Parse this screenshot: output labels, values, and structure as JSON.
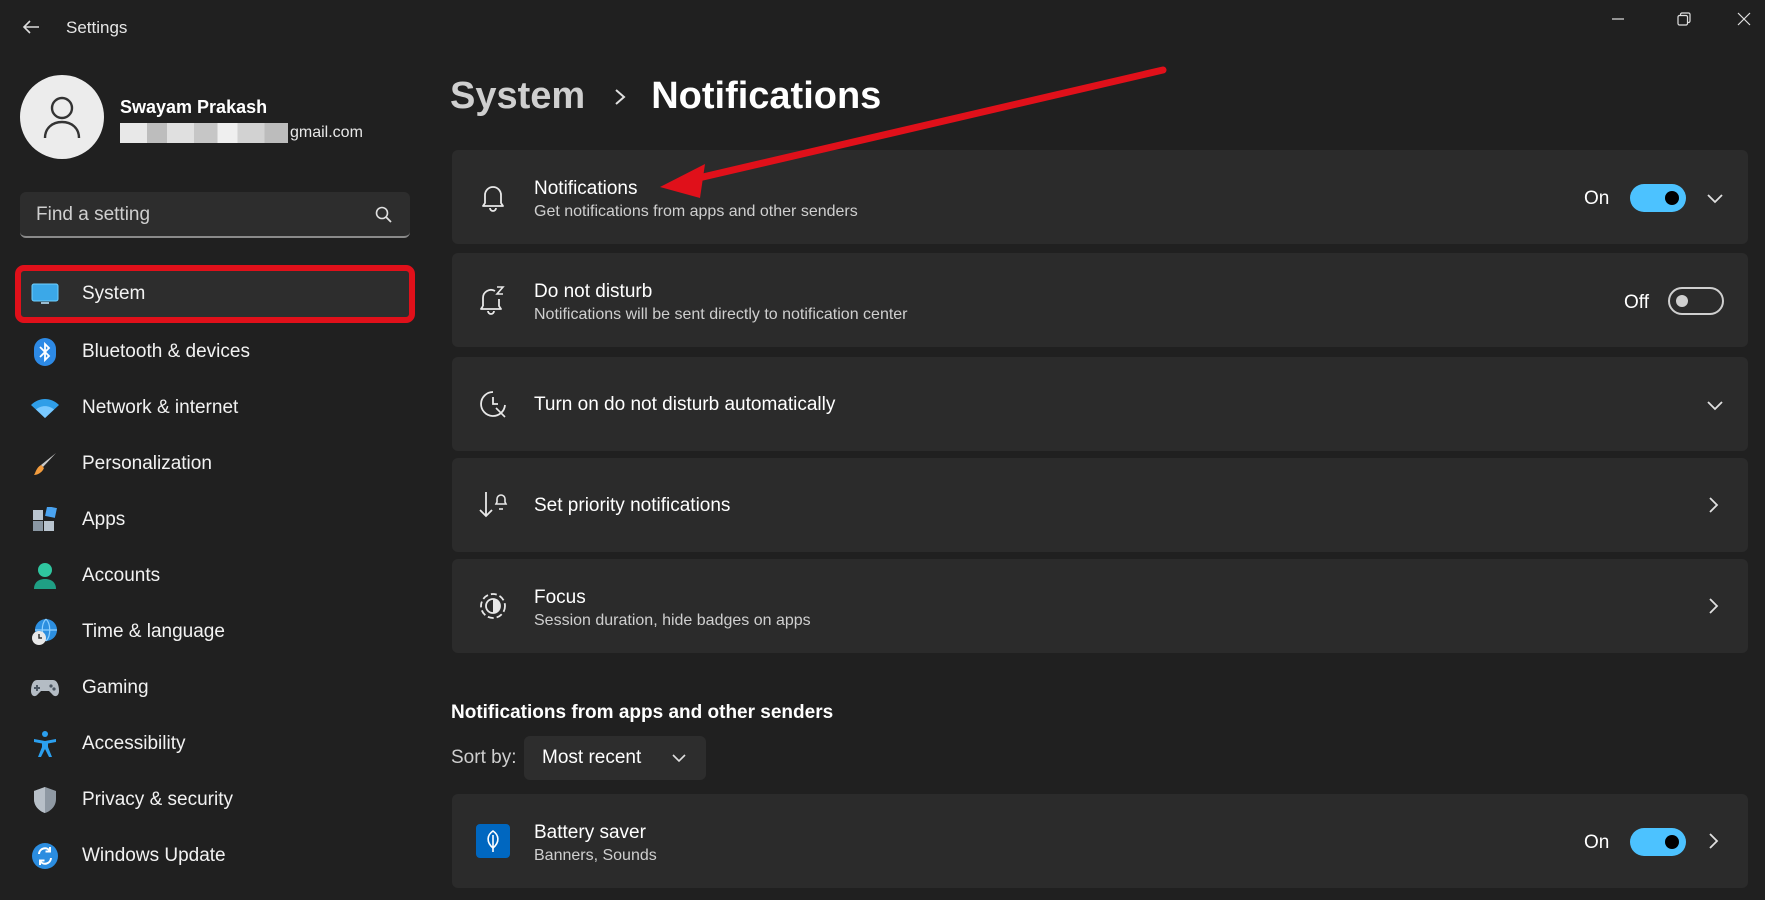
{
  "window": {
    "title": "Settings"
  },
  "profile": {
    "name": "Swayam Prakash",
    "email_visible": "gmail.com"
  },
  "search": {
    "placeholder": "Find a setting"
  },
  "sidebar": {
    "items": [
      {
        "label": "System",
        "icon": "display-icon",
        "active": true
      },
      {
        "label": "Bluetooth & devices",
        "icon": "bluetooth-icon"
      },
      {
        "label": "Network & internet",
        "icon": "wifi-icon"
      },
      {
        "label": "Personalization",
        "icon": "brush-icon"
      },
      {
        "label": "Apps",
        "icon": "apps-icon"
      },
      {
        "label": "Accounts",
        "icon": "person-icon"
      },
      {
        "label": "Time & language",
        "icon": "globe-clock-icon"
      },
      {
        "label": "Gaming",
        "icon": "gamepad-icon"
      },
      {
        "label": "Accessibility",
        "icon": "accessibility-icon"
      },
      {
        "label": "Privacy & security",
        "icon": "shield-icon"
      },
      {
        "label": "Windows Update",
        "icon": "update-icon"
      }
    ]
  },
  "breadcrumb": {
    "parent": "System",
    "current": "Notifications"
  },
  "settings": {
    "notifications": {
      "title": "Notifications",
      "subtitle": "Get notifications from apps and other senders",
      "state": "On",
      "enabled": true
    },
    "dnd": {
      "title": "Do not disturb",
      "subtitle": "Notifications will be sent directly to notification center",
      "state": "Off",
      "enabled": false
    },
    "dnd_auto": {
      "title": "Turn on do not disturb automatically"
    },
    "priority": {
      "title": "Set priority notifications"
    },
    "focus": {
      "title": "Focus",
      "subtitle": "Session duration, hide badges on apps"
    }
  },
  "senders": {
    "section_title": "Notifications from apps and other senders",
    "sort_label": "Sort by:",
    "sort_value": "Most recent",
    "items": [
      {
        "title": "Battery saver",
        "subtitle": "Banners, Sounds",
        "state": "On",
        "enabled": true,
        "icon": "leaf-icon"
      }
    ]
  },
  "colors": {
    "background": "#202020",
    "card": "#2b2b2b",
    "accent": "#4cc2ff",
    "annotation_red": "#e0101a"
  }
}
